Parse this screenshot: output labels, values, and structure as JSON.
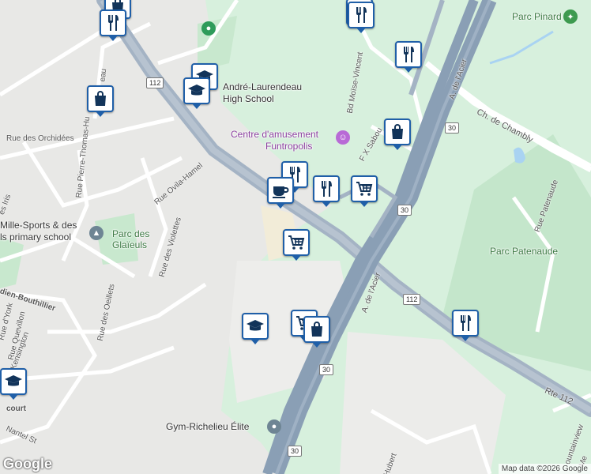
{
  "map": {
    "colors": {
      "residential": "#e8e8e6",
      "green": "#d7f0dd",
      "highway": "#8a9fb5",
      "arterial": "#a4b3c4",
      "marker_border": "#1f5fa8"
    },
    "places": {
      "parc_pinard": "Parc Pinard",
      "andre_laurendeau": "André-Laurendeau",
      "high_school": "High School",
      "funtropolis_1": "Centre d'amusement",
      "funtropolis_2": "Funtropolis",
      "parc_glaieuls_1": "Parc des",
      "parc_glaieuls_2": "Glaïeuls",
      "mille_sports_1": "Mille-Sports & des",
      "mille_sports_2": "ls primary school",
      "parc_patenaude": "Parc Patenaude",
      "gym": "Gym-Richelieu Élite"
    },
    "streets": {
      "orchidees": "Rue des Orchidées",
      "pierre_thomas": "Rue Pierre-Thomas-Hu",
      "beau": "eau",
      "ovila_hamel": "Rue Ovila-Hamel",
      "iris": "es Iris",
      "violettes": "Rue des Violettes",
      "oeillets": "Rue des Oeillets",
      "quevillon": "Rue Quevillon",
      "york": "Rue d'York",
      "kensington": "e Kensington",
      "bouthillier": "dien-Bouthillier",
      "court": "court",
      "nantel": "Nantel St",
      "moise_vincent": "Bd Moïse-Vincent",
      "fx_sabourin": "F X Sabou",
      "de_lacier_top": "A. de l'Acier",
      "de_lacier_mid": "A. de l'Acier",
      "chambly": "Ch. de Chambly",
      "patenaude": "Rue Patenaude",
      "rte112": "Rte 112",
      "hubert": "-Hubert",
      "fountainview": "ountainview",
      "me": "Me"
    },
    "shields": [
      "112",
      "30",
      "30",
      "112",
      "30",
      "30"
    ],
    "markers": [
      {
        "name": "shopping-bag-marker",
        "icon": "shopping-bag-icon"
      },
      {
        "name": "restaurant-marker",
        "icon": "restaurant-icon"
      },
      {
        "name": "shopping-bag-marker",
        "icon": "shopping-bag-icon"
      },
      {
        "name": "restaurant-marker",
        "icon": "restaurant-icon"
      },
      {
        "name": "school-marker",
        "icon": "graduation-cap-icon"
      },
      {
        "name": "school-marker",
        "icon": "graduation-cap-icon"
      },
      {
        "name": "shopping-bag-marker",
        "icon": "shopping-bag-icon"
      },
      {
        "name": "shopping-bag-marker",
        "icon": "shopping-bag-icon"
      },
      {
        "name": "restaurant-marker",
        "icon": "restaurant-icon"
      },
      {
        "name": "restaurant-marker",
        "icon": "restaurant-icon"
      },
      {
        "name": "cafe-marker",
        "icon": "coffee-cup-icon"
      },
      {
        "name": "restaurant-marker",
        "icon": "restaurant-icon"
      },
      {
        "name": "shopping-cart-marker",
        "icon": "shopping-cart-icon"
      },
      {
        "name": "shopping-cart-marker",
        "icon": "shopping-cart-icon"
      },
      {
        "name": "school-marker",
        "icon": "graduation-cap-icon"
      },
      {
        "name": "shopping-cart-marker",
        "icon": "shopping-cart-icon"
      },
      {
        "name": "shopping-bag-marker",
        "icon": "shopping-bag-icon"
      },
      {
        "name": "restaurant-marker",
        "icon": "restaurant-icon"
      },
      {
        "name": "school-marker",
        "icon": "graduation-cap-icon"
      }
    ],
    "google_logo": "Google",
    "attribution": "Map data ©2026 Google"
  }
}
